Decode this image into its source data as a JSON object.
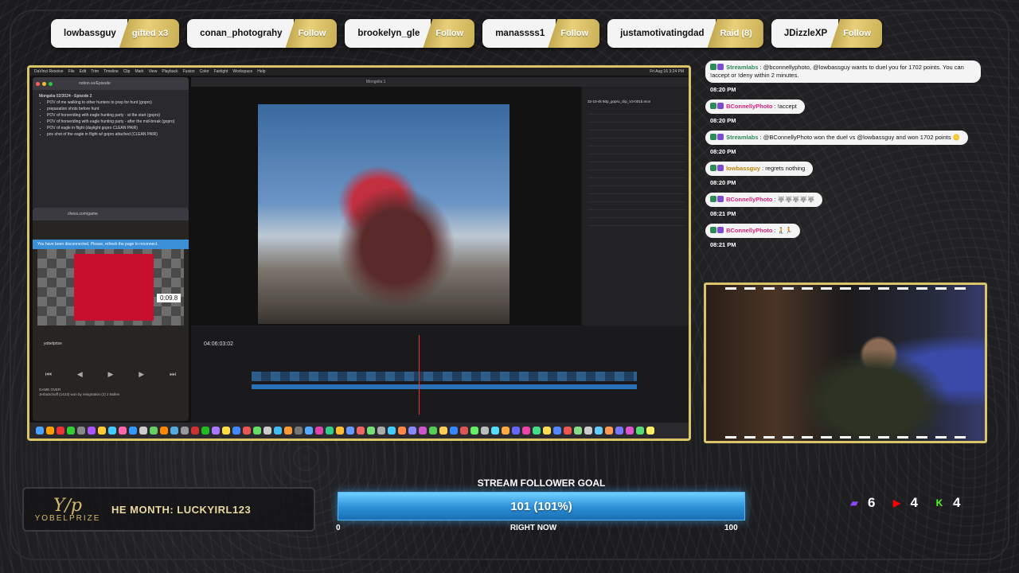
{
  "alerts": [
    {
      "name": "lowbassguy",
      "action": "gifted x3"
    },
    {
      "name": "conan_photograhy",
      "action": "Follow"
    },
    {
      "name": "brookelyn_gle",
      "action": "Follow"
    },
    {
      "name": "manassss1",
      "action": "Follow"
    },
    {
      "name": "justamotivatingdad",
      "action": "Raid (8)"
    },
    {
      "name": "JDizzleXP",
      "action": "Follow"
    }
  ],
  "screen": {
    "menubar": [
      "DaVinci Resolve",
      "File",
      "Edit",
      "Trim",
      "Timeline",
      "Clip",
      "Mark",
      "View",
      "Playback",
      "Fusion",
      "Color",
      "Fairlight",
      "Workspace",
      "Help"
    ],
    "clock": "Fri Aug 16 3:24 PM",
    "browser": {
      "url": "notion.so/Episode",
      "title": "Mongolia 02/2024 - Episode 2",
      "items": [
        "POV of me walking to other hunters to prep for hunt (gopro)",
        "preparation shots before hunt",
        "POV of horseriding with eagle hunting party - at the start (gopro)",
        "POV of horseriding with eagle hunting party - after the mid-break (gopro)",
        "POV of eagle in flight (daylight gopro CLEAN PAIR)",
        "pov shot of the eagle in flight w/ gopro attached (CLEAN PAIR)"
      ]
    },
    "chess": {
      "url": "chess.com/game",
      "banner": "You have been disconnected. Please, refresh the page to reconnect.",
      "player": "yobelprize",
      "timer": "0:09.8",
      "log": [
        "GAME OVER",
        "JerbaSchoff (1423) won by resignation (2) 2 Bulles"
      ]
    },
    "resolve": {
      "project": "Mongolia 1",
      "timecode": "04:06:03:02",
      "clip": "32-10-4k 60p_gopro_clip_V3-001b.mov"
    }
  },
  "chat": [
    {
      "user": "Streamlabs",
      "text": "@bconnellyphoto, @lowbassguy wants to duel you for 1702 points. You can !accept or !deny within 2 minutes.",
      "time": "08:20 PM",
      "color": "#2e8b57"
    },
    {
      "user": "BConnellyPhoto",
      "text": "!accept",
      "time": "08:20 PM",
      "color": "#d4237a"
    },
    {
      "user": "Streamlabs",
      "text": "@BConnellyPhoto won the duel vs @lowbassguy and won 1702 points 🪙",
      "time": "08:20 PM",
      "color": "#2e8b57"
    },
    {
      "user": "lowbassguy",
      "text": "regrets nothing",
      "time": "08:20 PM",
      "color": "#b8860b"
    },
    {
      "user": "BConnellyPhoto",
      "text": "🐺🐺🐺🐺🐺",
      "time": "08:21 PM",
      "color": "#d4237a"
    },
    {
      "user": "BConnellyPhoto",
      "text": "🧎🏃",
      "time": "08:21 PM",
      "color": "#d4237a"
    }
  ],
  "bottom": {
    "logo_word": "YOBELPRIZE",
    "motm_text": "HE MONTH: LUCKYIRL123",
    "goal": {
      "title": "STREAM FOLLOWER GOAL",
      "value_label": "101 (101%)",
      "progress": 1.0,
      "min": "0",
      "max": "100",
      "sub": "RIGHT NOW"
    },
    "socials": [
      {
        "platform": "twitch-icon",
        "count": "6",
        "color": "#9146ff"
      },
      {
        "platform": "youtube-icon",
        "count": "4",
        "color": "#ff0000"
      },
      {
        "platform": "kick-icon",
        "count": "4",
        "color": "#53fc18"
      }
    ]
  }
}
